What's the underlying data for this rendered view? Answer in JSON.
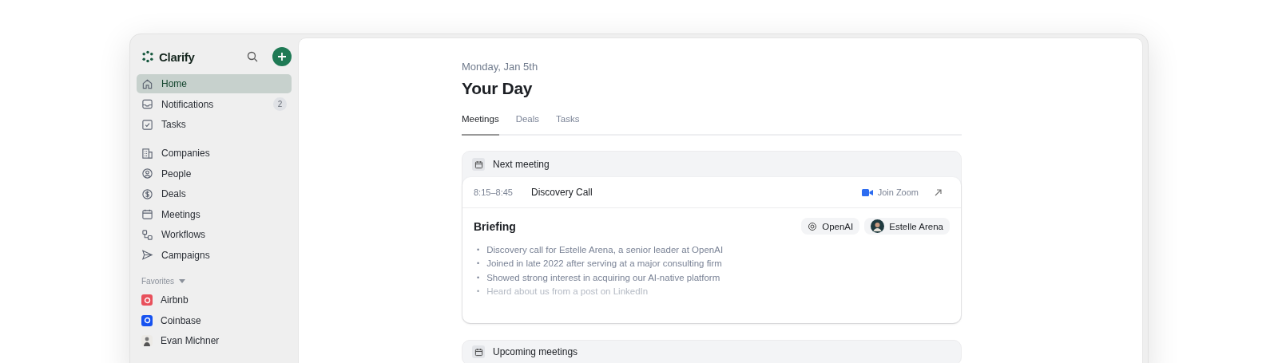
{
  "sidebar": {
    "brand": "Clarify",
    "nav_groups": [
      {
        "items": [
          {
            "label": "Home",
            "selected": true
          },
          {
            "label": "Notifications",
            "selected": false,
            "badge": "2"
          },
          {
            "label": "Tasks",
            "selected": false
          }
        ]
      },
      {
        "items": [
          {
            "label": "Companies",
            "selected": false
          },
          {
            "label": "People",
            "selected": false
          },
          {
            "label": "Deals",
            "selected": false
          },
          {
            "label": "Meetings",
            "selected": false
          },
          {
            "label": "Workflows",
            "selected": false
          },
          {
            "label": "Campaigns",
            "selected": false
          }
        ]
      }
    ],
    "favorites_label": "Favorites",
    "favorites": [
      {
        "label": "Airbnb",
        "kind": "logo",
        "color": "#e8505b"
      },
      {
        "label": "Coinbase",
        "kind": "logo",
        "color": "#1652f0"
      },
      {
        "label": "Evan Michner",
        "kind": "avatar"
      }
    ]
  },
  "main": {
    "date": "Monday, Jan 5th",
    "title": "Your Day",
    "tabs": [
      {
        "label": "Meetings",
        "selected": true
      },
      {
        "label": "Deals",
        "selected": false
      },
      {
        "label": "Tasks",
        "selected": false
      }
    ],
    "next_meeting": {
      "heading": "Next meeting",
      "time": "8:15–8:45",
      "name": "Discovery Call",
      "join": "Join Zoom",
      "briefing_title": "Briefing",
      "chips": [
        {
          "label": "OpenAI",
          "kind": "company"
        },
        {
          "label": "Estelle Arena",
          "kind": "person"
        }
      ],
      "bullets": [
        {
          "marker": "•",
          "text": "Discovery call for Estelle Arena, a senior leader at OpenAI",
          "faded": false
        },
        {
          "marker": "•",
          "text": "Joined in late 2022 after serving at a major consulting firm",
          "faded": false
        },
        {
          "marker": "•",
          "text": "Showed strong interest in acquiring our AI-native platform",
          "faded": false
        },
        {
          "marker": "•",
          "text": "Heard about us from a post on LinkedIn",
          "faded": true
        }
      ]
    },
    "upcoming_heading": "Upcoming meetings"
  }
}
